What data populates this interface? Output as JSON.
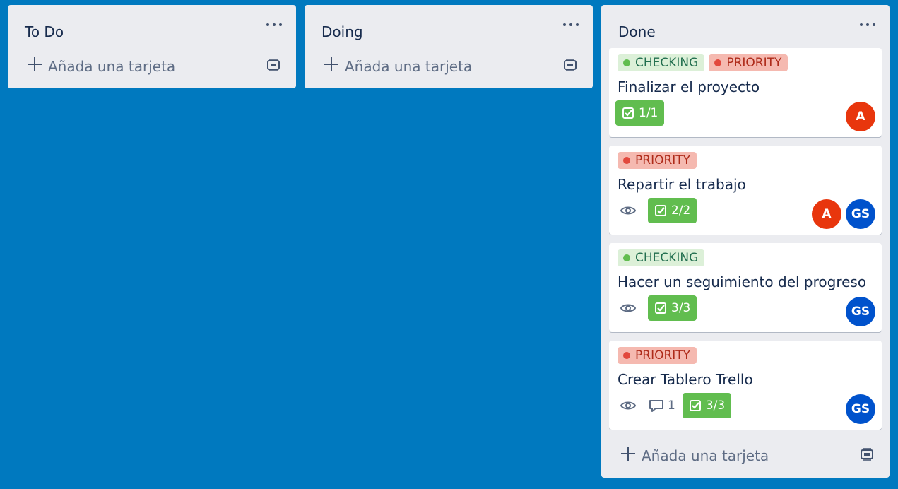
{
  "colors": {
    "board_bg": "#0079bf",
    "list_bg": "#ebecf0",
    "checklist_complete": "#61bd4f",
    "label_green": "#61bd4f",
    "label_red": "#e2483d",
    "avatar_a": "#e8360d",
    "avatar_gs": "#0052cc"
  },
  "lists": [
    {
      "title": "To Do",
      "add_card_label": "Añada una tarjeta"
    },
    {
      "title": "Doing",
      "add_card_label": "Añada una tarjeta"
    },
    {
      "title": "Done",
      "add_card_label": "Añada una tarjeta",
      "cards": [
        {
          "labels": [
            "CHECKING",
            "PRIORITY"
          ],
          "title": "Finalizar el proyecto",
          "checklist": "1/1",
          "avatars": [
            "A"
          ]
        },
        {
          "labels": [
            "PRIORITY"
          ],
          "title": "Repartir el trabajo",
          "checklist": "2/2",
          "avatars": [
            "A",
            "GS"
          ]
        },
        {
          "labels": [
            "CHECKING"
          ],
          "title": "Hacer un seguimiento del progreso",
          "checklist": "3/3",
          "avatars": [
            "GS"
          ]
        },
        {
          "labels": [
            "PRIORITY"
          ],
          "title": "Crear Tablero Trello",
          "comments": "1",
          "checklist": "3/3",
          "avatars": [
            "GS"
          ]
        }
      ]
    }
  ]
}
